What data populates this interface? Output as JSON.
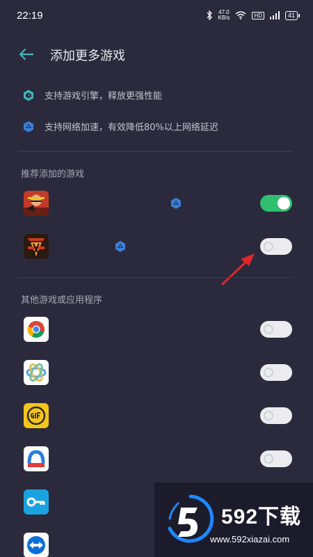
{
  "status_bar": {
    "time": "22:19",
    "net_speed_top": "47.0",
    "net_speed_bottom": "KB/s",
    "hd_badge": "HD",
    "battery": "41"
  },
  "header": {
    "title": "添加更多游戏"
  },
  "features": [
    {
      "icon": "engine-icon",
      "text": "支持游戏引擎，释放更强性能"
    },
    {
      "icon": "network-boost-icon",
      "text": "支持网络加速，有效降低80%以上网络延迟"
    }
  ],
  "sections": {
    "recommended_label": "推荐添加的游戏",
    "others_label": "其他游戏或应用程序"
  },
  "recommended_apps": [
    {
      "icon": "one-piece-game-icon",
      "enabled": true,
      "network_boost": true
    },
    {
      "icon": "sanguosha-game-icon",
      "enabled": false,
      "network_boost": true
    }
  ],
  "other_apps": [
    {
      "icon": "chrome-icon",
      "enabled": false
    },
    {
      "icon": "photo-app-icon",
      "enabled": false
    },
    {
      "icon": "gif-app-icon",
      "enabled": false
    },
    {
      "icon": "store-app-icon",
      "enabled": false
    },
    {
      "icon": "key-app-icon",
      "enabled": false
    },
    {
      "icon": "teamviewer-icon",
      "enabled": false
    }
  ],
  "colors": {
    "background": "#2b2a3d",
    "toggle_on": "#2fbf6f",
    "toggle_off": "#ececef",
    "accent": "#3fb6ba",
    "arrow": "#e0262a"
  },
  "watermark": {
    "brand": "592下载",
    "url": "www.592xiazai.com"
  }
}
